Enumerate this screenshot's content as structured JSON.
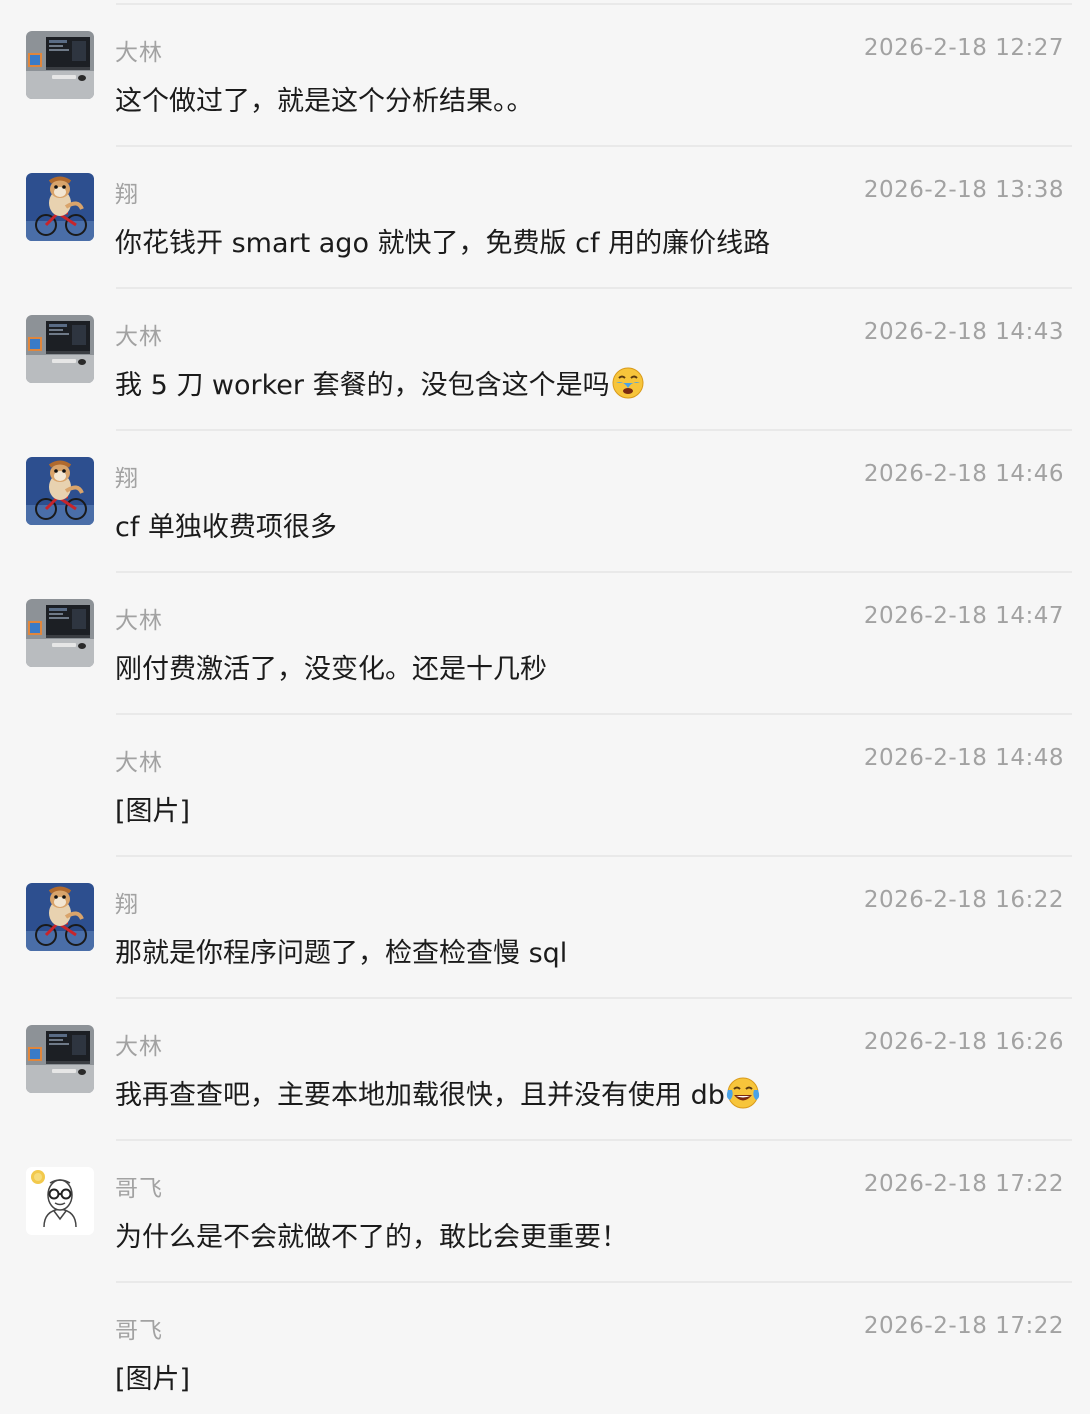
{
  "messages": [
    {
      "sender": "大林",
      "time": "2026-2-18 12:27",
      "text": "这个做过了，就是这个分析结果。。",
      "avatar": "desk-setup-avatar",
      "emoji": ""
    },
    {
      "sender": "翔",
      "time": "2026-2-18 13:38",
      "text": "你花钱开 smart ago 就快了，免费版 cf 用的廉价线路",
      "avatar": "hamster-bike-avatar",
      "emoji": ""
    },
    {
      "sender": "大林",
      "time": "2026-2-18 14:43",
      "text": "我 5 刀 worker 套餐的，没包含这个是吗",
      "avatar": "desk-setup-avatar",
      "emoji": "crying-face-emoji"
    },
    {
      "sender": "翔",
      "time": "2026-2-18 14:46",
      "text": "cf 单独收费项很多",
      "avatar": "hamster-bike-avatar",
      "emoji": ""
    },
    {
      "sender": "大林",
      "time": "2026-2-18 14:47",
      "text": "刚付费激活了，没变化。还是十几秒",
      "avatar": "desk-setup-avatar",
      "emoji": ""
    },
    {
      "sender": "大林",
      "time": "2026-2-18 14:48",
      "text": "[图片]",
      "avatar": "",
      "emoji": ""
    },
    {
      "sender": "翔",
      "time": "2026-2-18 16:22",
      "text": "那就是你程序问题了，检查检查慢 sql",
      "avatar": "hamster-bike-avatar",
      "emoji": ""
    },
    {
      "sender": "大林",
      "time": "2026-2-18 16:26",
      "text": "我再查查吧，主要本地加载很快，且并没有使用 db",
      "avatar": "desk-setup-avatar",
      "emoji": "tears-of-joy-emoji"
    },
    {
      "sender": "哥飞",
      "time": "2026-2-18 17:22",
      "text": "为什么是不会就做不了的，敢比会更重要！",
      "avatar": "glasses-man-avatar",
      "emoji": ""
    },
    {
      "sender": "哥飞",
      "time": "2026-2-18 17:22",
      "text": "[图片]",
      "avatar": "",
      "emoji": ""
    }
  ],
  "colors": {
    "background": "#f6f6f6",
    "meta_text": "#a2a2a2",
    "body_text": "#1b1b1b",
    "divider": "#e9e9e9"
  }
}
